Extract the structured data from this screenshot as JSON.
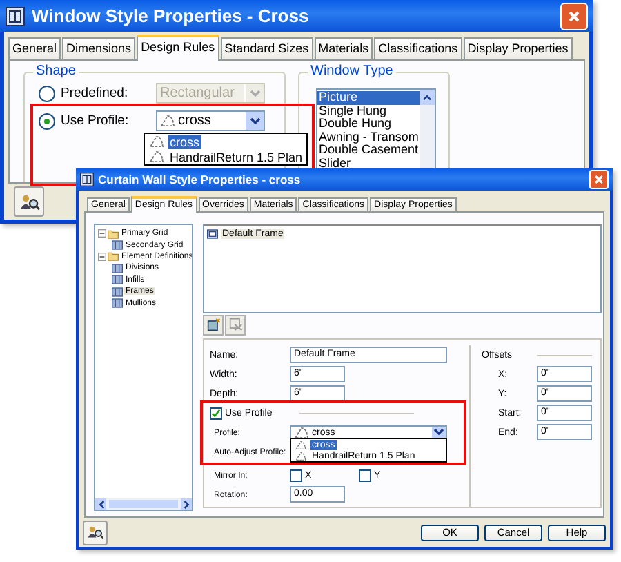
{
  "back_window": {
    "title": "Window Style Properties - Cross",
    "tabs": [
      {
        "label": "General",
        "selected": false
      },
      {
        "label": "Dimensions",
        "selected": false
      },
      {
        "label": "Design Rules",
        "selected": true
      },
      {
        "label": "Standard Sizes",
        "selected": false
      },
      {
        "label": "Materials",
        "selected": false
      },
      {
        "label": "Classifications",
        "selected": false
      },
      {
        "label": "Display Properties",
        "selected": false
      }
    ],
    "shape": {
      "title": "Shape",
      "options": [
        {
          "label": "Predefined:",
          "selected": false,
          "value": "Rectangular",
          "disabled": true
        },
        {
          "label": "Use Profile:",
          "selected": true,
          "value": "cross",
          "disabled": false
        }
      ],
      "profile_items": [
        {
          "label": "cross",
          "selected": true
        },
        {
          "label": "HandrailReturn 1.5 Plan",
          "selected": false
        }
      ]
    },
    "window_type": {
      "title": "Window Type",
      "items": [
        {
          "label": "Picture",
          "selected": true
        },
        {
          "label": "Single Hung",
          "selected": false
        },
        {
          "label": "Double Hung",
          "selected": false
        },
        {
          "label": "Awning - Transom",
          "selected": false
        },
        {
          "label": "Double Casement",
          "selected": false
        },
        {
          "label": "Slider",
          "selected": false
        }
      ]
    }
  },
  "front_window": {
    "title": "Curtain Wall Style Properties - cross",
    "tabs": [
      {
        "label": "General",
        "selected": false
      },
      {
        "label": "Design Rules",
        "selected": true
      },
      {
        "label": "Overrides",
        "selected": false
      },
      {
        "label": "Materials",
        "selected": false
      },
      {
        "label": "Classifications",
        "selected": false
      },
      {
        "label": "Display Properties",
        "selected": false
      }
    ],
    "tree": [
      {
        "label": "Primary Grid",
        "expanded": true,
        "selected": false,
        "children": [
          {
            "label": "Secondary Grid",
            "selected": false
          }
        ]
      },
      {
        "label": "Element Definitions",
        "expanded": true,
        "selected": false,
        "children": [
          {
            "label": "Divisions",
            "selected": false
          },
          {
            "label": "Infills",
            "selected": false
          },
          {
            "label": "Frames",
            "selected": true
          },
          {
            "label": "Mullions",
            "selected": false
          }
        ]
      }
    ],
    "list": [
      {
        "label": "Default Frame"
      }
    ],
    "fields": [
      {
        "label": "Name:",
        "value": "Default Frame",
        "wide": true
      },
      {
        "label": "Width:",
        "value": "6\"",
        "wide": false
      },
      {
        "label": "Depth:",
        "value": "6\"",
        "wide": false
      }
    ],
    "use_profile": {
      "label": "Use Profile",
      "checked": true
    },
    "profile": {
      "label": "Profile:",
      "value": "cross",
      "items": [
        {
          "label": "cross",
          "selected": true
        },
        {
          "label": "HandrailReturn 1.5 Plan",
          "selected": false
        }
      ]
    },
    "auto_adjust": {
      "label": "Auto-Adjust Profile:"
    },
    "mirror": {
      "label": "Mirror In:",
      "options": [
        {
          "label": "X",
          "checked": false
        },
        {
          "label": "Y",
          "checked": false
        }
      ]
    },
    "rotation": {
      "label": "Rotation:",
      "value": "0.00"
    },
    "offsets": {
      "title": "Offsets",
      "fields": [
        {
          "label": "X:",
          "value": "0\""
        },
        {
          "label": "Y:",
          "value": "0\""
        },
        {
          "label": "Start:",
          "value": "0\""
        },
        {
          "label": "End:",
          "value": "0\""
        }
      ]
    },
    "buttons": [
      "OK",
      "Cancel",
      "Help"
    ]
  }
}
